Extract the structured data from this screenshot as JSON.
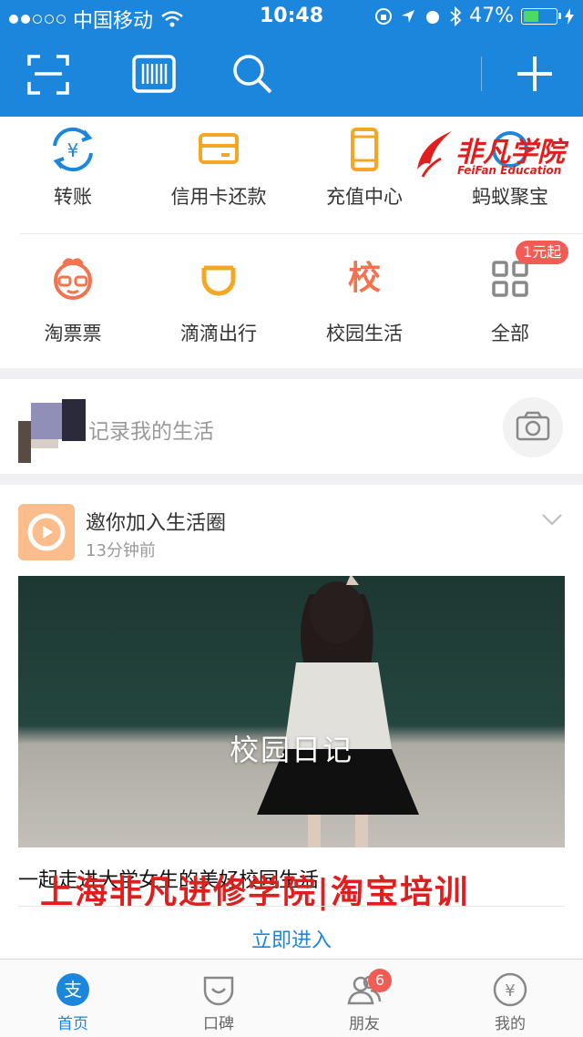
{
  "status_bar": {
    "carrier": "中国移动",
    "time": "10:48",
    "battery": "47%",
    "battery_level": 0.47
  },
  "toolbar": {
    "icons": [
      "scan-icon",
      "barcode-icon",
      "search-icon",
      "add-icon"
    ]
  },
  "shortcuts": [
    {
      "label": "转账",
      "icon": "transfer-icon",
      "color": "#1c86dd"
    },
    {
      "label": "信用卡还款",
      "icon": "credit-card-icon",
      "color": "#f5a623"
    },
    {
      "label": "充值中心",
      "icon": "phone-recharge-icon",
      "color": "#f5a623"
    },
    {
      "label": "蚂蚁聚宝",
      "icon": "ant-fortune-icon",
      "color": "#1c86dd"
    },
    {
      "label": "淘票票",
      "icon": "taopiaopiao-icon",
      "color": "#f2734f"
    },
    {
      "label": "滴滴出行",
      "icon": "didi-icon",
      "color": "#f5a623"
    },
    {
      "label": "校园生活",
      "icon": "campus-icon",
      "icon_text": "校",
      "color": "#f2734f"
    },
    {
      "label": "全部",
      "icon": "grid-all-icon",
      "color": "#888888"
    }
  ],
  "promo_badge": "1元起",
  "record": {
    "placeholder": "记录我的生活"
  },
  "feed": {
    "title": "邀你加入生活圈",
    "time": "13分钟前",
    "image_caption": "校园日记",
    "description": "一起走进大学女生的美好校园生活",
    "enter_label": "立即进入"
  },
  "watermark": {
    "brand_name": "非凡学院",
    "brand_sub": "FeiFan Education",
    "banner": "上海非凡进修学院|淘宝培训"
  },
  "tabs": [
    {
      "label": "首页",
      "icon": "home-icon",
      "active": true
    },
    {
      "label": "口碑",
      "icon": "koubei-icon"
    },
    {
      "label": "朋友",
      "icon": "friends-icon",
      "badge": "6"
    },
    {
      "label": "我的",
      "icon": "my-account-icon"
    }
  ],
  "colors": {
    "primary": "#1c86dd",
    "badge": "#f25c54",
    "watermark": "#e11e1e"
  }
}
